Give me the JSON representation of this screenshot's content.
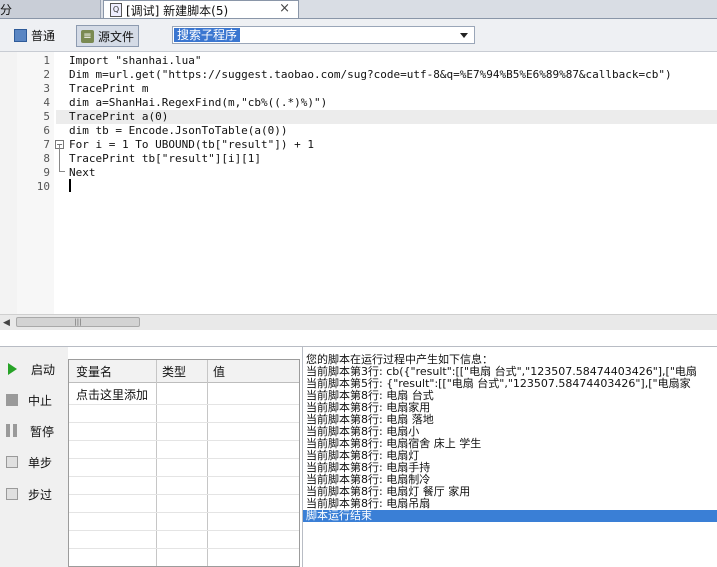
{
  "tabs": {
    "left_label": "分",
    "active_title": "[调试] 新建脚本(5)",
    "close_glyph": "×"
  },
  "toolbar": {
    "normal_label": "普通",
    "source_label": "源文件",
    "subroutine_select_value": "搜索子程序"
  },
  "editor": {
    "line_numbers": [
      "1",
      "2",
      "3",
      "4",
      "5",
      "6",
      "7",
      "8",
      "9",
      "10"
    ],
    "lines": [
      "Import \"shanhai.lua\"",
      "Dim m=url.get(\"https://suggest.taobao.com/sug?code=utf-8&q=%E7%94%B5%E6%89%87&callback=cb\")",
      "TracePrint m",
      "dim a=ShanHai.RegexFind(m,\"cb%((.*)%)\")",
      "TracePrint a(0)",
      "dim tb = Encode.JsonToTable(a(0))",
      "For i = 1 To UBOUND(tb[\"result\"]) + 1",
      "TracePrint tb[\"result\"][i][1]",
      "Next",
      ""
    ]
  },
  "debug": {
    "start_label": "启动",
    "stop_label": "中止",
    "pause_label": "暂停",
    "step_label": "单步",
    "step_over_label": "步过"
  },
  "variables": {
    "col_name": "变量名",
    "col_type": "类型",
    "col_value": "值",
    "add_row_label": "点击这里添加"
  },
  "output": {
    "lines": [
      "您的脚本在运行过程中产生如下信息：",
      "当前脚本第3行: cb({\"result\":[[\"电扇 台式\",\"123507.58474403426\"],[\"电扇",
      "当前脚本第5行: {\"result\":[[\"电扇 台式\",\"123507.58474403426\"],[\"电扇家",
      "当前脚本第8行: 电扇 台式",
      "当前脚本第8行: 电扇家用",
      "当前脚本第8行: 电扇 落地",
      "当前脚本第8行: 电扇小",
      "当前脚本第8行: 电扇宿舍 床上 学生",
      "当前脚本第8行: 电扇灯",
      "当前脚本第8行: 电扇手持",
      "当前脚本第8行: 电扇制冷",
      "当前脚本第8行: 电扇灯 餐厅 家用",
      "当前脚本第8行: 电扇吊扇"
    ],
    "end_line": "脚本运行结束"
  }
}
